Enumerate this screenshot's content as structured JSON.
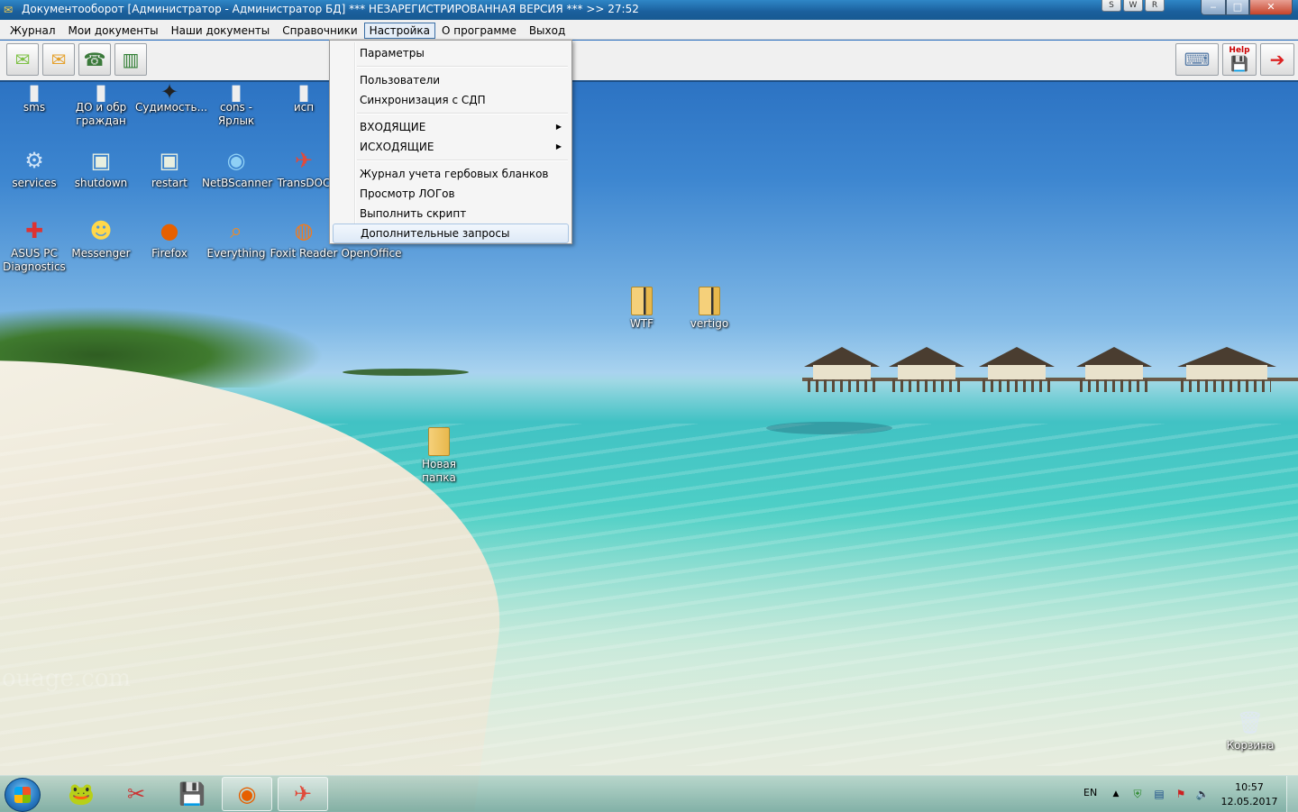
{
  "window": {
    "title": "Документооборот [Администратор - Администратор БД]  *** НЕЗАРЕГИСТРИРОВАННАЯ ВЕРСИЯ  ***  >> 27:52",
    "extra_buttons": [
      "S",
      "W",
      "R"
    ],
    "controls": {
      "minimize": "‒",
      "maximize": "□",
      "close": "✕"
    }
  },
  "menubar": {
    "items": [
      "Журнал",
      "Мои документы",
      "Наши документы",
      "Справочники",
      "Настройка",
      "О программе",
      "Выход"
    ],
    "active_index": 4
  },
  "toolbar": {
    "left_buttons": [
      "incoming-mail-icon",
      "outgoing-mail-icon",
      "phone-doc-icon",
      "chart-icon"
    ],
    "right_buttons": [
      "network-icon",
      "help-icon",
      "exit-icon"
    ],
    "help_label": "Help"
  },
  "dropdown": {
    "items": [
      {
        "label": "Параметры"
      },
      {
        "label": "Пользователи"
      },
      {
        "label": "Синхронизация с СДП"
      },
      {
        "label": "ВХОДЯЩИЕ",
        "submenu": true
      },
      {
        "label": "ИСХОДЯЩИЕ",
        "submenu": true
      },
      {
        "label": "Журнал учета гербовых бланков"
      },
      {
        "label": "Просмотр ЛОГов"
      },
      {
        "label": "Выполнить скрипт"
      },
      {
        "label": "Дополнительные запросы",
        "highlighted": true
      }
    ],
    "submenu_arrow": "▶"
  },
  "desktop": {
    "icons": [
      {
        "label": "sms",
        "icon": "sms-icon",
        "glyph": "▮"
      },
      {
        "label": "ДО и обр граждан",
        "icon": "document-icon",
        "glyph": "▮"
      },
      {
        "label": "Судимость...",
        "icon": "dark-app-icon",
        "glyph": "✦"
      },
      {
        "label": "cons - Ярлык",
        "icon": "shortcut-icon",
        "glyph": "▮"
      },
      {
        "label": "исп",
        "icon": "app-icon",
        "glyph": "▮"
      },
      {
        "label": "services",
        "icon": "gear-icon",
        "glyph": "⚙"
      },
      {
        "label": "shutdown",
        "icon": "shutdown-icon",
        "glyph": "▣"
      },
      {
        "label": "restart",
        "icon": "restart-icon",
        "glyph": "▣"
      },
      {
        "label": "NetBScanner",
        "icon": "scanner-icon",
        "glyph": "◉"
      },
      {
        "label": "TransDOC",
        "icon": "transdoc-icon",
        "glyph": "✈"
      },
      {
        "label": "ASUS PC Diagnostics",
        "icon": "diagnostics-icon",
        "glyph": "✚"
      },
      {
        "label": "Messenger",
        "icon": "messenger-icon",
        "glyph": "☻"
      },
      {
        "label": "Firefox",
        "icon": "firefox-icon",
        "glyph": "●"
      },
      {
        "label": "Everything",
        "icon": "search-icon",
        "glyph": "⌕"
      },
      {
        "label": "Foxit Reader",
        "icon": "foxit-icon",
        "glyph": "◍"
      },
      {
        "label": "OpenOffice",
        "icon": "openoffice-icon",
        "glyph": ""
      }
    ],
    "folders": [
      {
        "label": "WTF",
        "icon": "folder-icon"
      },
      {
        "label": "vertigo",
        "icon": "folder-icon"
      },
      {
        "label": "Новая папка",
        "icon": "folder-icon"
      }
    ],
    "recycle_bin": {
      "label": "Корзина",
      "icon": "recycle-bin-icon",
      "glyph": "🗑"
    },
    "watermark": "ouage.com"
  },
  "taskbar": {
    "apps": [
      {
        "name": "frog-app-icon",
        "glyph": "🐸",
        "open": false
      },
      {
        "name": "scissors-app-icon",
        "glyph": "✂",
        "open": false
      },
      {
        "name": "floppy-app-icon",
        "glyph": "💾",
        "open": false
      },
      {
        "name": "firefox-app-icon",
        "glyph": "◉",
        "open": true
      },
      {
        "name": "transdoc-app-icon",
        "glyph": "✈",
        "open": true
      }
    ],
    "language": "EN",
    "tray_icons": [
      "up-arrow-icon",
      "shield-icon",
      "network-icon",
      "flag-icon",
      "volume-icon"
    ],
    "time": "10:57",
    "date": "12.05.2017"
  },
  "colors": {
    "titlebar": "#1a5f9c",
    "menubar": "#f0f0f0",
    "menu_highlight": "#dde9f7",
    "close_button": "#c7432a"
  }
}
